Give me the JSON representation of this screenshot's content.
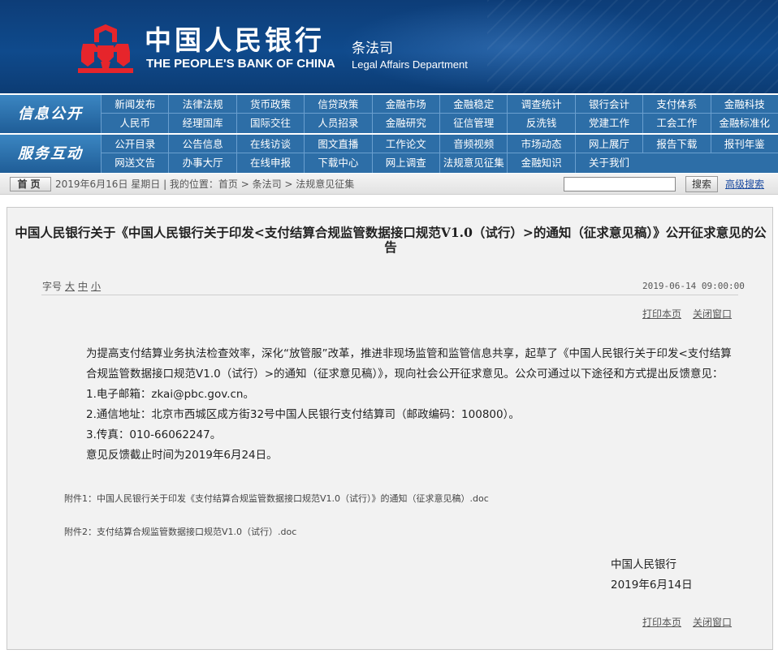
{
  "header": {
    "cn_name": "中国人民银行",
    "en_name": "THE PEOPLE'S BANK OF CHINA",
    "dept_cn": "条法司",
    "dept_en": "Legal Affairs Department",
    "colors": {
      "bg": "#0f4a8c",
      "logo": "#e6252b"
    }
  },
  "nav": {
    "section1_label": "信息公开",
    "section2_label": "服务互动",
    "row1": [
      "新闻发布",
      "法律法规",
      "货币政策",
      "信贷政策",
      "金融市场",
      "金融稳定",
      "调查统计",
      "银行会计",
      "支付体系",
      "金融科技"
    ],
    "row2": [
      "人民币",
      "经理国库",
      "国际交往",
      "人员招录",
      "金融研究",
      "征信管理",
      "反洗钱",
      "党建工作",
      "工会工作",
      "金融标准化"
    ],
    "row3": [
      "公开目录",
      "公告信息",
      "在线访谈",
      "图文直播",
      "工作论文",
      "音频视频",
      "市场动态",
      "网上展厅",
      "报告下载",
      "报刊年鉴"
    ],
    "row4": [
      "网送文告",
      "办事大厅",
      "在线申报",
      "下载中心",
      "网上调查",
      "法规意见征集",
      "金融知识",
      "关于我们"
    ]
  },
  "infobar": {
    "home_label": "首页",
    "date_text": "2019年6月16日 星期日 | 我的位置：首页 > 条法司 > 法规意见征集",
    "search_button": "搜索",
    "advanced_search": "高级搜索",
    "search_value": ""
  },
  "article": {
    "title": "中国人民银行关于《中国人民银行关于印发<支付结算合规监管数据接口规范V1.0（试行）>的通知（征求意见稿）》公开征求意见的公告",
    "fontsize_label": "字号",
    "fontsize_large": "大",
    "fontsize_medium": "中",
    "fontsize_small": "小",
    "date": "2019-06-14 09:00:00",
    "print": "打印本页",
    "close": "关闭窗口",
    "para1": "为提高支付结算业务执法检查效率，深化“放管服”改革，推进非现场监管和监管信息共享，起草了《中国人民银行关于印发<支付结算合规监管数据接口规范V1.0（试行）>的通知（征求意见稿）》，现向社会公开征求意见。公众可通过以下途径和方式提出反馈意见：",
    "item1": "1.电子邮箱：zkai@pbc.gov.cn。",
    "item2": "2.通信地址：北京市西城区成方街32号中国人民银行支付结算司（邮政编码：100800）。",
    "item3": "3.传真：010-66062247。",
    "deadline": "意见反馈截止时间为2019年6月24日。",
    "attachment1": "附件1：中国人民银行关于印发《支付结算合规监管数据接口规范V1.0（试行）》的通知（征求意见稿）.doc",
    "attachment2": "附件2：支付结算合规监管数据接口规范V1.0（试行）.doc",
    "signature": "中国人民银行",
    "sign_date": "2019年6月14日"
  }
}
